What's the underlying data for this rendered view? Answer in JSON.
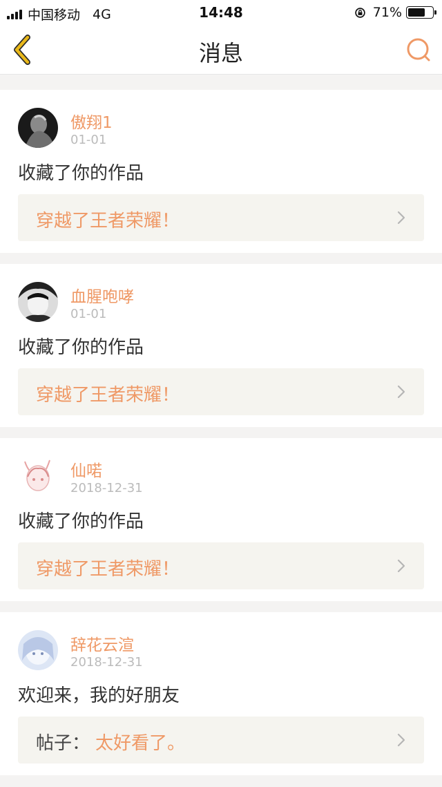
{
  "status_bar": {
    "carrier": "中国移动",
    "network": "4G",
    "time": "14:48",
    "battery": "71%",
    "battery_level": 0.71
  },
  "nav": {
    "title": "消息",
    "back_icon": "chevron-left-icon",
    "search_icon": "search-icon"
  },
  "colors": {
    "accent": "#ef9966",
    "back_icon": "#e9b81a",
    "background": "#f4f3f2",
    "ref_background": "#f5f4ef"
  },
  "messages": [
    {
      "username": "傲翔1",
      "date": "01-01",
      "text": "收藏了你的作品",
      "ref_prefix": "",
      "ref_title": "穿越了王者荣耀！"
    },
    {
      "username": "血腥咆哮",
      "date": "01-01",
      "text": "收藏了你的作品",
      "ref_prefix": "",
      "ref_title": "穿越了王者荣耀！"
    },
    {
      "username": "仙喏",
      "date": "2018-12-31",
      "text": "收藏了你的作品",
      "ref_prefix": "",
      "ref_title": "穿越了王者荣耀！"
    },
    {
      "username": "辞花云渲",
      "date": "2018-12-31",
      "text": "欢迎来，我的好朋友",
      "ref_prefix": "帖子：",
      "ref_title": "太好看了。"
    }
  ]
}
